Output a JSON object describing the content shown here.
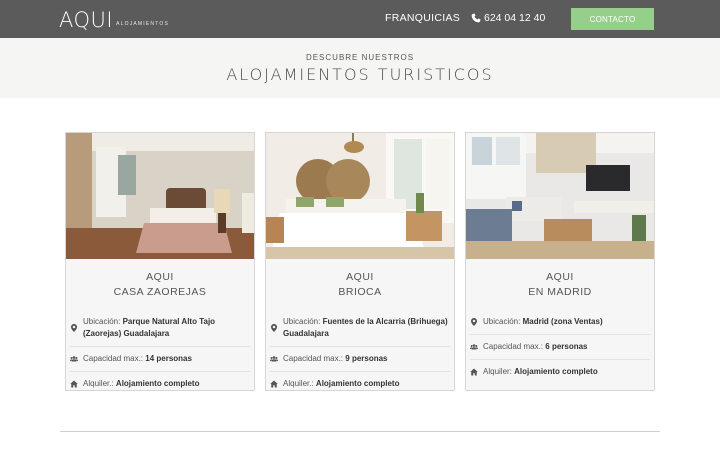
{
  "header": {
    "logo_main": "AQUI",
    "logo_sub": "ALOJAMIENTOS",
    "nav_franquicias": "FRANQUICIAS",
    "phone": "624 04 12 40",
    "contact_label": "CONTACTO"
  },
  "hero": {
    "kicker": "DESCUBRE NUESTROS",
    "title": "ALOJAMIENTOS TURISTICOS"
  },
  "cards": [
    {
      "brand": "AQUI",
      "name": "CASA ZAOREJAS",
      "location_label": "Ubicación:",
      "location_value": "Parque Natural Alto Tajo (Zaorejas) Guadalajara",
      "capacity_label": "Capacidad max.:",
      "capacity_value": "14 personas",
      "rental_label": "Alquiler.:",
      "rental_value": "Alojamiento completo"
    },
    {
      "brand": "AQUI",
      "name": "BRIOCA",
      "location_label": "Ubicación:",
      "location_value": "Fuentes de la Alcarria (Brihuega) Guadalajara",
      "capacity_label": "Capacidad max.:",
      "capacity_value": "9 personas",
      "rental_label": "Alquiler.:",
      "rental_value": "Alojamiento completo"
    },
    {
      "brand": "AQUI",
      "name": "EN MADRID",
      "location_label": "Ubicación:",
      "location_value": "Madrid (zona Ventas)",
      "capacity_label": "Capacidad max.:",
      "capacity_value": "6 personas",
      "rental_label": "Alquiler:",
      "rental_value": "Alojamiento completo"
    }
  ],
  "icons": {
    "phone": "phone-icon",
    "location": "map-marker-icon",
    "capacity": "users-icon",
    "rental": "home-icon"
  },
  "colors": {
    "topbar": "#5b5b5b",
    "contact_button": "#95cf8b",
    "hero_background": "#f5f5f3"
  }
}
